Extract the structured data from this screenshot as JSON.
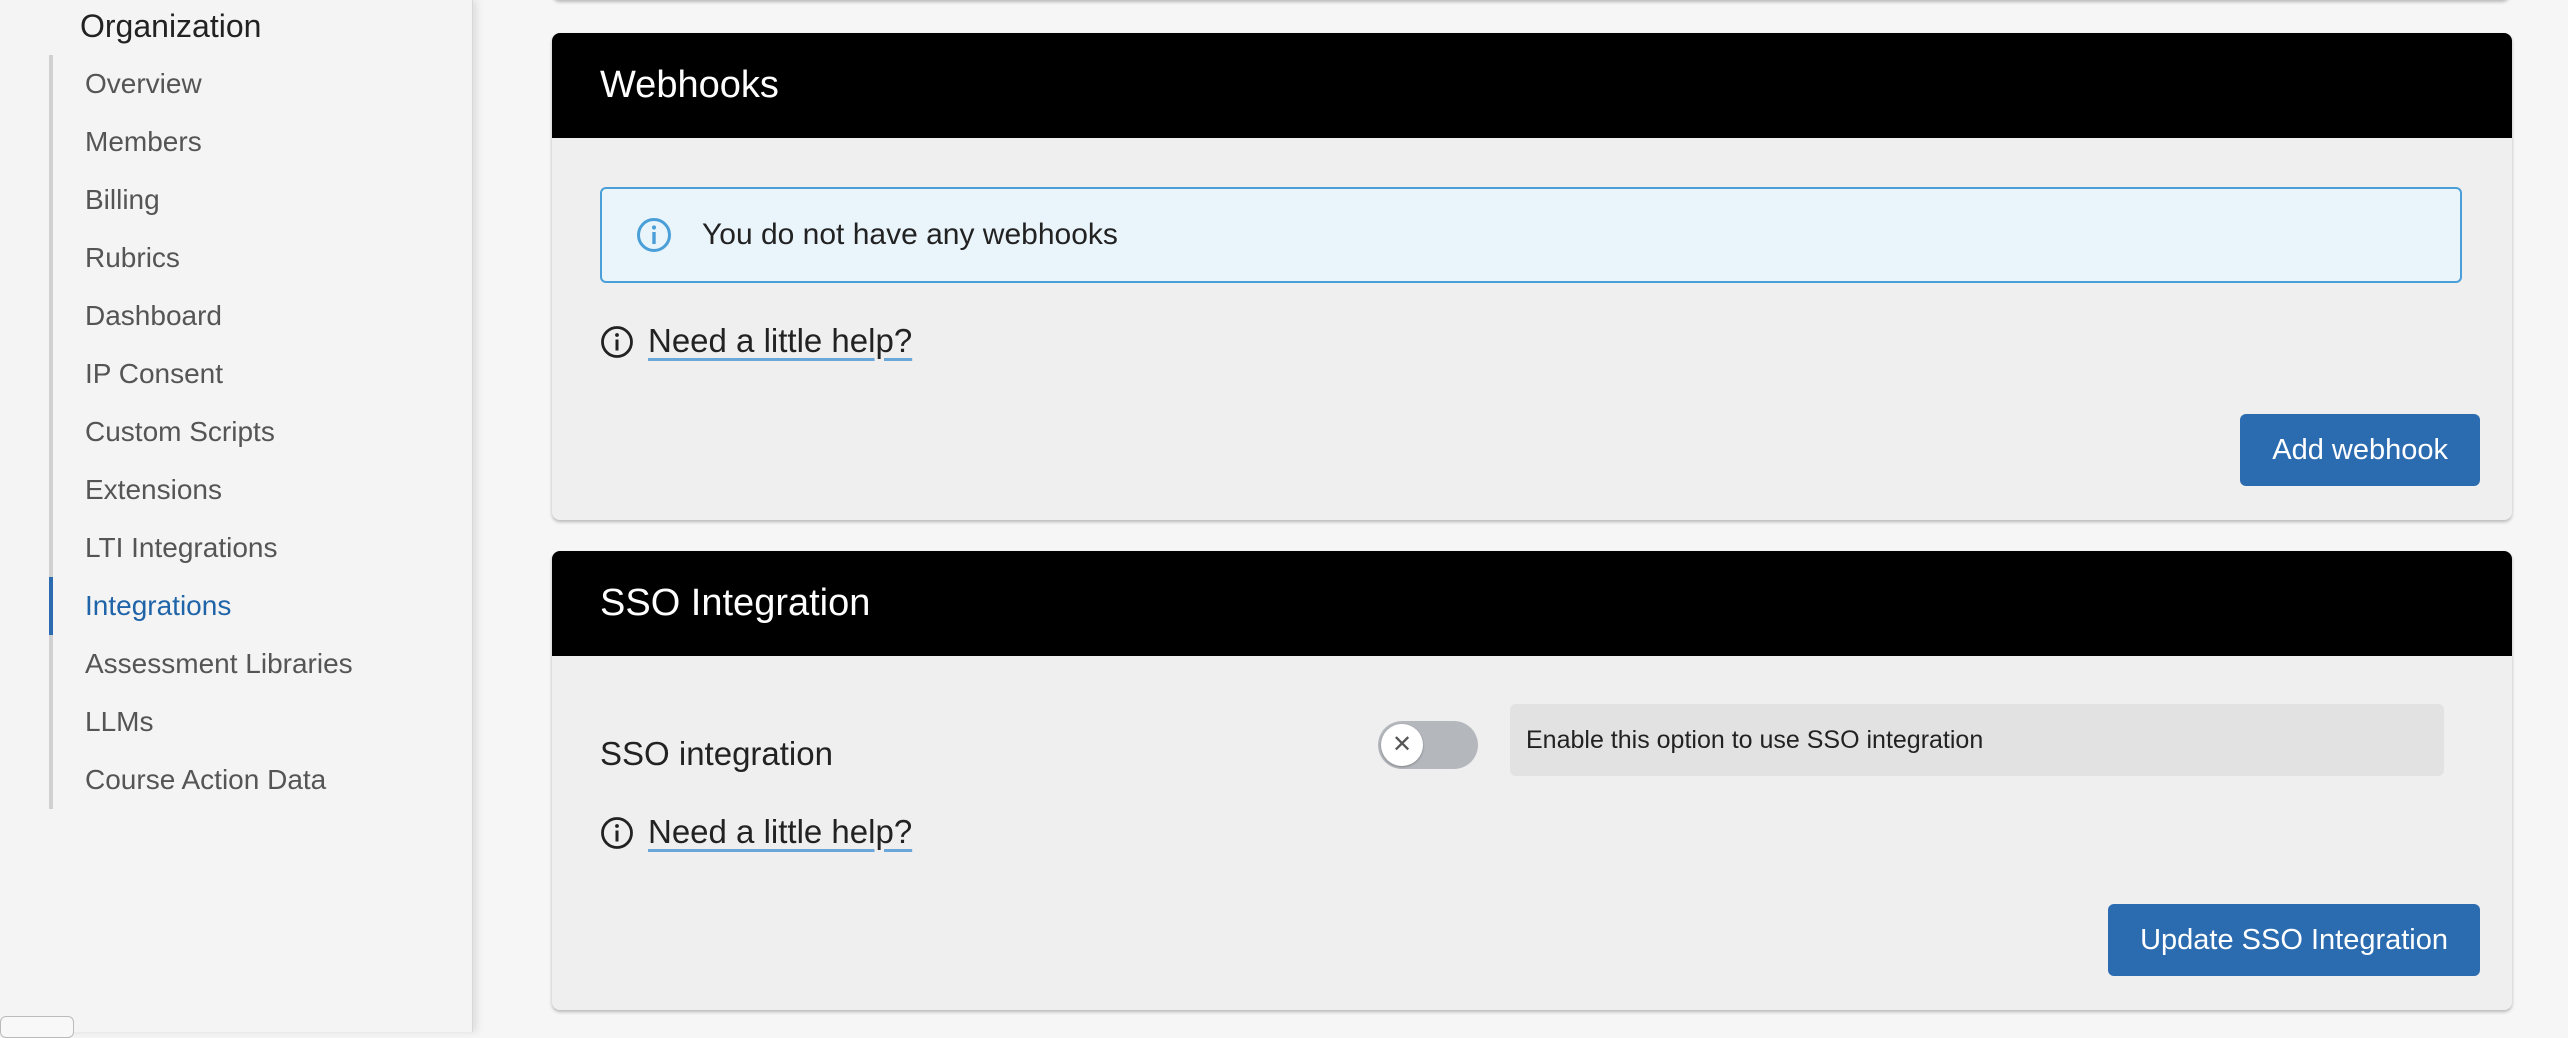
{
  "sidebar": {
    "title": "Organization",
    "items": [
      {
        "label": "Overview"
      },
      {
        "label": "Members"
      },
      {
        "label": "Billing"
      },
      {
        "label": "Rubrics"
      },
      {
        "label": "Dashboard"
      },
      {
        "label": "IP Consent"
      },
      {
        "label": "Custom Scripts"
      },
      {
        "label": "Extensions"
      },
      {
        "label": "LTI Integrations"
      },
      {
        "label": "Integrations",
        "active": true
      },
      {
        "label": "Assessment Libraries"
      },
      {
        "label": "LLMs"
      },
      {
        "label": "Course Action Data"
      }
    ]
  },
  "webhooks": {
    "title": "Webhooks",
    "empty_message": "You do not have any webhooks",
    "help_link": "Need a little help?",
    "add_button": "Add webhook"
  },
  "sso": {
    "title": "SSO Integration",
    "field_label": "SSO integration",
    "toggle_enabled": false,
    "description": "Enable this option to use SSO integration",
    "help_link": "Need a little help?",
    "update_button": "Update SSO Integration"
  },
  "colors": {
    "accent": "#2b6cb0",
    "active_nav": "#1f64a8",
    "card_header": "#000000",
    "info_border": "#4a9fd8",
    "info_bg": "#eaf4fb"
  },
  "icons": {
    "alert_icon": "info-circle-icon",
    "help_icon": "info-circle-outline-icon",
    "toggle_icon": "close-icon"
  }
}
